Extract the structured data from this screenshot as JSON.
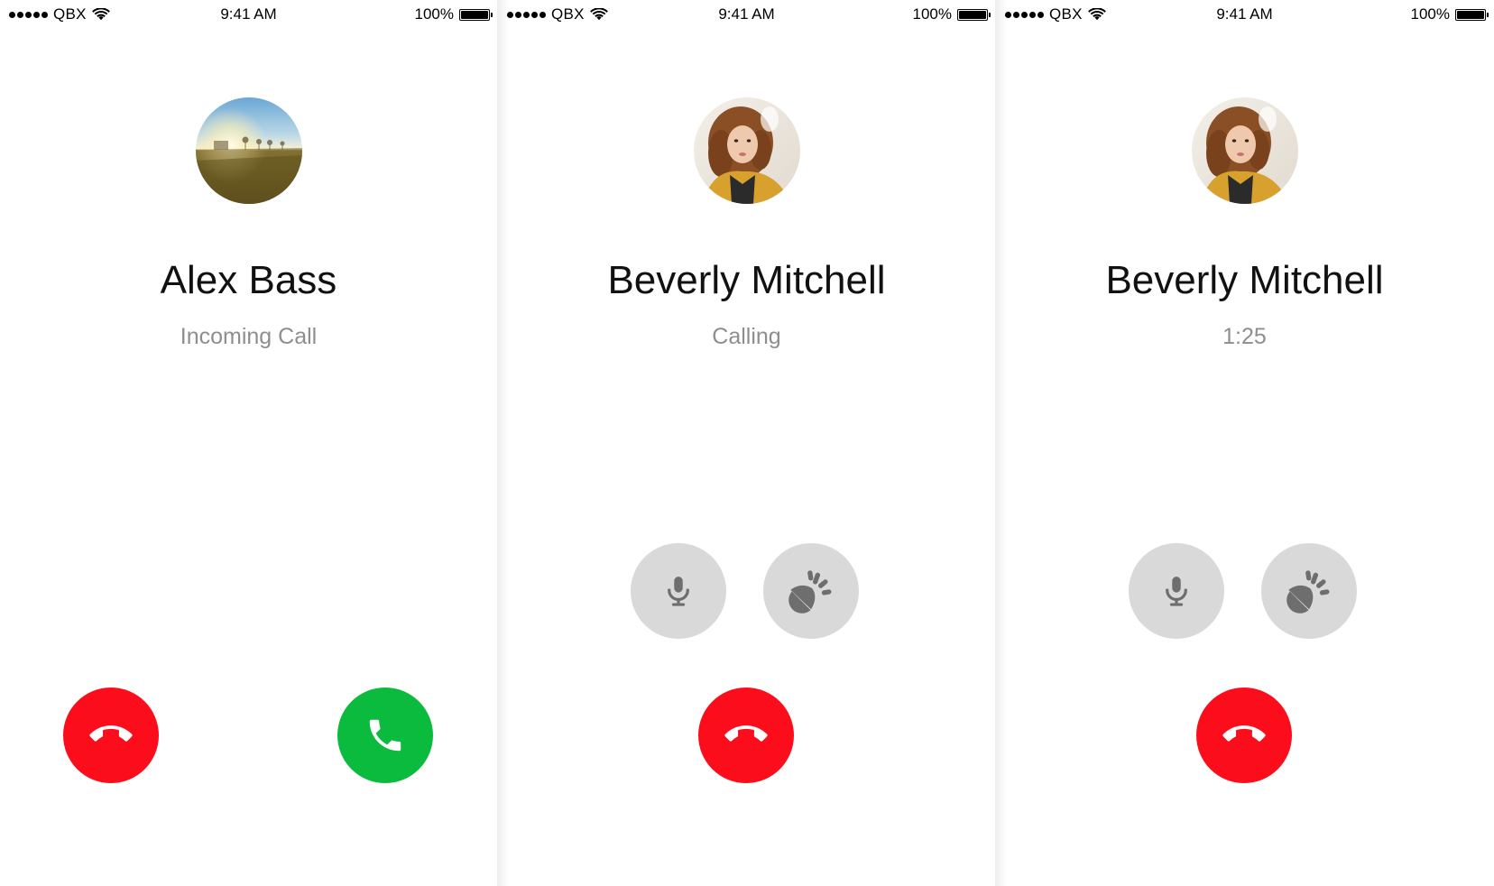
{
  "status_bar": {
    "carrier": "QBX",
    "time": "9:41 AM",
    "battery": "100%"
  },
  "screens": [
    {
      "caller_name": "Alex Bass",
      "call_status": "Incoming Call",
      "avatar_icon": "landscape-photo",
      "buttons": [
        "decline-call",
        "accept-call"
      ]
    },
    {
      "caller_name": "Beverly Mitchell",
      "call_status": "Calling",
      "avatar_icon": "person-photo",
      "buttons": [
        "microphone",
        "speaker",
        "end-call"
      ]
    },
    {
      "caller_name": "Beverly Mitchell",
      "call_status": "1:25",
      "avatar_icon": "person-photo",
      "buttons": [
        "microphone",
        "speaker",
        "end-call"
      ]
    }
  ],
  "colors": {
    "decline": "#fc0d1b",
    "accept": "#0abb3e",
    "control": "#d9d9d9",
    "control_icon": "#6e6e6e",
    "status_text": "#8e8e8e"
  }
}
